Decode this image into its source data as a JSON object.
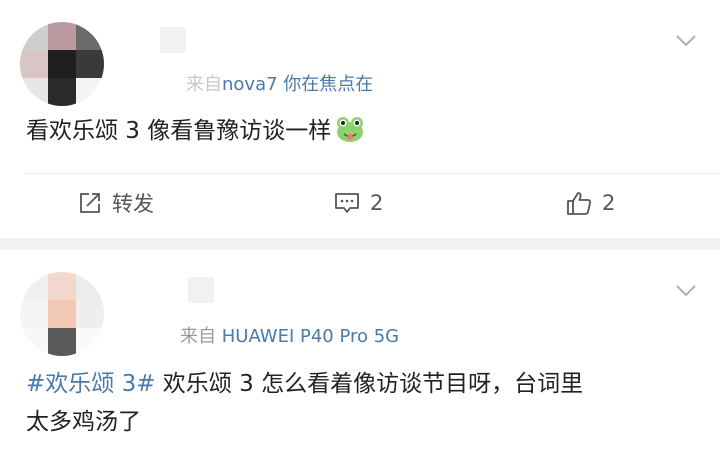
{
  "posts": [
    {
      "source_prefix": "来自",
      "device": "nova7 你在焦点在",
      "content": "看欢乐颂 3 像看鲁豫访谈一样",
      "emoji_icon": "frog-emoji-icon",
      "actions": {
        "repost_label": "转发",
        "comment_count": "2",
        "like_count": "2"
      }
    },
    {
      "source_prefix": "来自",
      "device": "HUAWEI P40 Pro 5G",
      "hashtag": "#欢乐颂 3#",
      "content_line1": " 欢乐颂 3 怎么看着像访谈节目呀，台词里",
      "content_line2": "太多鸡汤了"
    }
  ],
  "colors": {
    "link_blue": "#4a7aa8",
    "secondary_text": "#9a9a9a",
    "separator": "#f2f2f2"
  }
}
